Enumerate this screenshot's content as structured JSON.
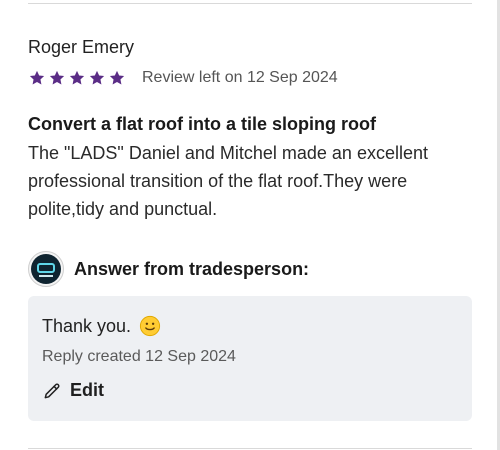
{
  "review": {
    "reviewer_name": "Roger Emery",
    "rating": 5,
    "date_text": "Review left on 12 Sep 2024",
    "title": "Convert a flat roof into a tile sloping roof",
    "body": "The \"LADS\" Daniel and Mitchel made an excellent professional transition of the flat roof.They were polite,tidy and punctual."
  },
  "answer": {
    "heading": "Answer from tradesperson:",
    "text": "Thank you.",
    "emoji": "slightly-smiling-face-icon",
    "reply_date_text": "Reply created 12 Sep 2024",
    "edit_label": "Edit"
  },
  "colors": {
    "star": "#5b2d86",
    "answer_box_bg": "#eef0f3",
    "divider": "#d9d9d9"
  }
}
